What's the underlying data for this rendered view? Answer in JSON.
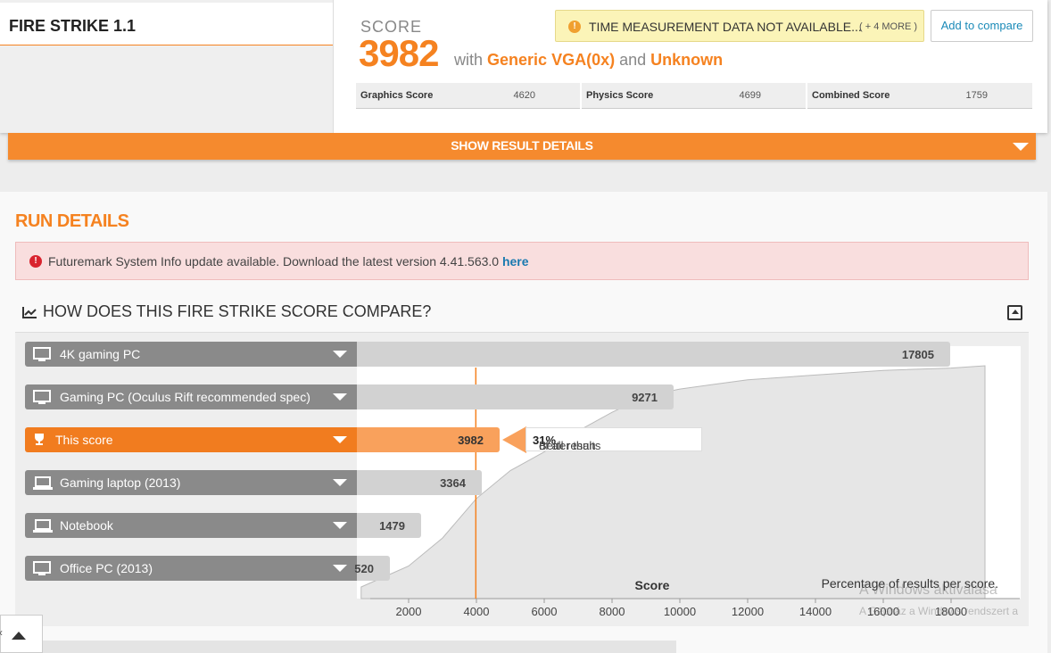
{
  "test": {
    "name": "FIRE STRIKE 1.1"
  },
  "score": {
    "label": "SCORE",
    "value": "3982",
    "with_text": "with",
    "gpu": "Generic VGA(0x)",
    "and_text": "and",
    "cpu": "Unknown"
  },
  "warning": {
    "icon": "warning-icon",
    "text": "TIME MEASUREMENT DATA NOT AVAILABLE...",
    "more": "( + 4 MORE )"
  },
  "actions": {
    "add_to_compare": "Add to compare"
  },
  "subscores": [
    {
      "name": "Graphics Score",
      "value": "4620"
    },
    {
      "name": "Physics Score",
      "value": "4699"
    },
    {
      "name": "Combined Score",
      "value": "1759"
    }
  ],
  "show_details": {
    "label": "SHOW RESULT DETAILS"
  },
  "run_details": {
    "title": "RUN DETAILS",
    "alert": {
      "text": "Futuremark System Info update available. Download the latest version 4.41.563.0",
      "link": "here"
    }
  },
  "compare": {
    "heading": "HOW DOES THIS FIRE STRIKE SCORE COMPARE?",
    "rows": [
      {
        "label": "4K gaming PC",
        "value": "17805",
        "icon": "desktop-icon",
        "active": false
      },
      {
        "label": "Gaming PC (Oculus Rift recommended spec)",
        "value": "9271",
        "icon": "desktop-icon",
        "active": false
      },
      {
        "label": "This score",
        "value": "3982",
        "icon": "trophy-icon",
        "active": true
      },
      {
        "label": "Gaming laptop (2013)",
        "value": "3364",
        "icon": "laptop-icon",
        "active": false
      },
      {
        "label": "Notebook",
        "value": "1479",
        "icon": "laptop-icon",
        "active": false
      },
      {
        "label": "Office PC (2013)",
        "value": "520",
        "icon": "desktop-icon",
        "active": false
      }
    ],
    "better_prefix": "Better than",
    "better_pct": "31%",
    "better_suffix": "of all results",
    "xlabel": "Score",
    "curve_label": "Percentage of results per score.",
    "ticks": [
      "2000",
      "4000",
      "6000",
      "8000",
      "10000",
      "12000",
      "14000",
      "16000",
      "18000"
    ]
  },
  "chart_data": {
    "type": "area",
    "title": "",
    "xlabel": "Score",
    "ylabel": "",
    "xlim": [
      0,
      19000
    ],
    "x": [
      600,
      2000,
      3000,
      4000,
      5000,
      6000,
      7000,
      8000,
      9000,
      10000,
      11000,
      12000,
      14000,
      16000,
      18000,
      19000
    ],
    "y": [
      0.05,
      0.14,
      0.26,
      0.43,
      0.55,
      0.63,
      0.72,
      0.8,
      0.87,
      0.9,
      0.92,
      0.94,
      0.96,
      0.98,
      0.99,
      1.0
    ],
    "marker": {
      "x": 3982,
      "label": "Better than 31% of all results"
    },
    "annotation": "Percentage of results per score."
  },
  "watermark": {
    "line1": "A Windows aktiválása",
    "line2": "A Gépház a Windows rendszert a"
  },
  "colors": {
    "accent": "#f58220",
    "bar": "#d2d2d2",
    "label_bg": "#8a8a8a",
    "active_bar": "#f9a15c"
  }
}
